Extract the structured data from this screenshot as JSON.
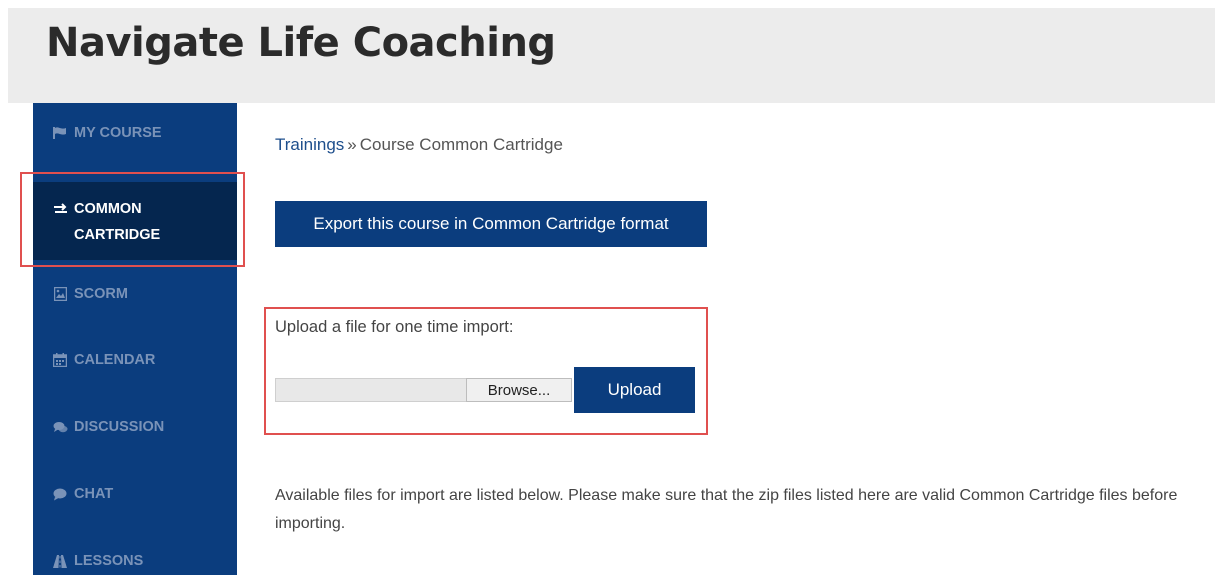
{
  "site": {
    "title": "Navigate Life Coaching"
  },
  "sidebar": {
    "items": [
      {
        "label": "MY COURSE",
        "icon": "flag-icon"
      },
      {
        "label": "COMMON CARTRIDGE",
        "icon": "swap-arrows-icon",
        "active": true
      },
      {
        "label": "SCORM",
        "icon": "image-file-icon"
      },
      {
        "label": "CALENDAR",
        "icon": "calendar-icon"
      },
      {
        "label": "DISCUSSION",
        "icon": "comments-icon"
      },
      {
        "label": "CHAT",
        "icon": "chat-bubble-icon"
      },
      {
        "label": "LESSONS",
        "icon": "road-icon"
      }
    ]
  },
  "breadcrumb": {
    "parent": "Trainings",
    "separator": "»",
    "current": "Course Common Cartridge"
  },
  "main": {
    "export_button_label": "Export this course in Common Cartridge format",
    "upload_label": "Upload a file for one time import:",
    "browse_button_label": "Browse...",
    "upload_button_label": "Upload",
    "info_text": "Available files for import are listed below. Please make sure that the zip files listed here are valid Common Cartridge files before importing."
  },
  "colors": {
    "sidebar_bg": "#0b3d7e",
    "sidebar_active_bg": "#05264f",
    "header_bg": "#ececec",
    "highlight": "#e0504f",
    "button_bg": "#0b3d7e"
  }
}
